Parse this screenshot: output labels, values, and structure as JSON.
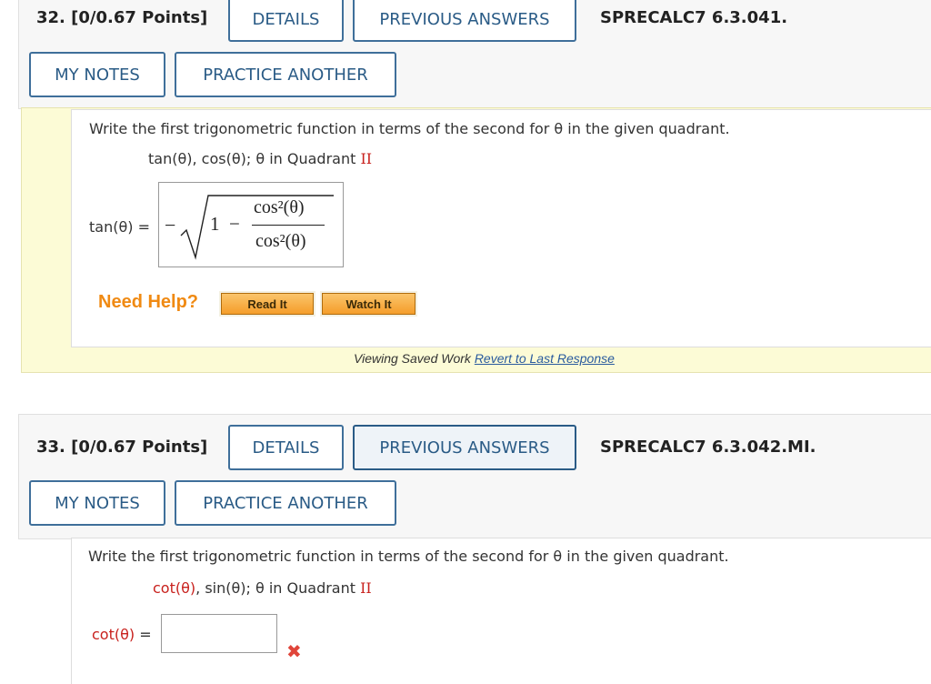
{
  "q32": {
    "number": "32.",
    "points": "[0/0.67 Points]",
    "details": "DETAILS",
    "previous_answers": "PREVIOUS ANSWERS",
    "source": "SPRECALC7 6.3.041.",
    "my_notes": "MY NOTES",
    "practice_another": "PRACTICE ANOTHER",
    "prompt": "Write the first trigonometric function in terms of the second for θ in the given quadrant.",
    "sub_funcs": "tan(θ), cos(θ); θ in Quadrant ",
    "quadrant": "II",
    "answer_label": "tan(θ) =",
    "answer": {
      "sign": "−",
      "one": "1",
      "minus": "−",
      "numerator": "cos²(θ)",
      "denominator": "cos²(θ)"
    },
    "need_help": "Need Help?",
    "read_it": "Read It",
    "watch_it": "Watch It",
    "saved_text": "Viewing Saved Work",
    "revert": "Revert to Last Response"
  },
  "q33": {
    "number": "33.",
    "points": "[0/0.67 Points]",
    "details": "DETAILS",
    "previous_answers": "PREVIOUS ANSWERS",
    "source": "SPRECALC7 6.3.042.MI.",
    "my_notes": "MY NOTES",
    "practice_another": "PRACTICE ANOTHER",
    "prompt": "Write the first trigonometric function in terms of the second for θ in the given quadrant.",
    "sub_func1": "cot(θ)",
    "sub_rest": ", sin(θ); θ in Quadrant ",
    "quadrant": "II",
    "answer_label_func": "cot(θ)",
    "answer_label_eq": " =",
    "answer_value": "",
    "incorrect_mark": "✖"
  },
  "colors": {
    "accent": "#2a5b86",
    "red": "#c8211d",
    "help_orange": "#f08a13",
    "panel_yellow": "#fcfbd6"
  }
}
